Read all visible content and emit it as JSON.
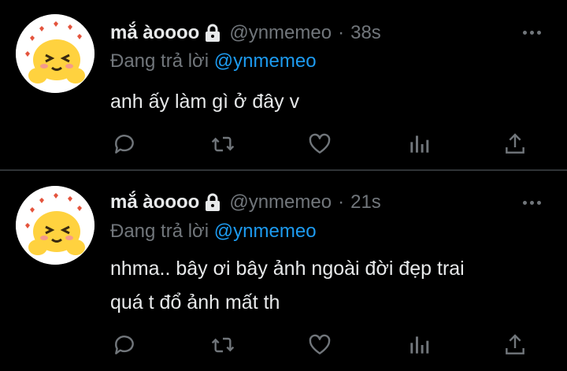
{
  "tweets": [
    {
      "name": "mắ àoooo",
      "handle": "@ynmemeo",
      "separator": "·",
      "time": "38s",
      "reply_prefix": "Đang trả lời",
      "reply_to": "@ynmemeo",
      "text_lines": [
        "anh ấy làm gì ở đây v"
      ]
    },
    {
      "name": "mắ àoooo",
      "handle": "@ynmemeo",
      "separator": "·",
      "time": "21s",
      "reply_prefix": "Đang trả lời",
      "reply_to": "@ynmemeo",
      "text_lines": [
        "nhma.. bây ơi bây ảnh ngoài đời đẹp trai",
        "quá t đổ ảnh mất th"
      ]
    }
  ],
  "icons": {
    "reply": "reply-icon",
    "retweet": "retweet-icon",
    "like": "heart-icon",
    "views": "views-icon",
    "share": "share-icon",
    "more": "more-icon",
    "lock": "lock-icon"
  },
  "colors": {
    "background": "#000000",
    "text": "#e7e9ea",
    "muted": "#71767b",
    "accent": "#1d9bf0",
    "divider": "#2f3336"
  }
}
